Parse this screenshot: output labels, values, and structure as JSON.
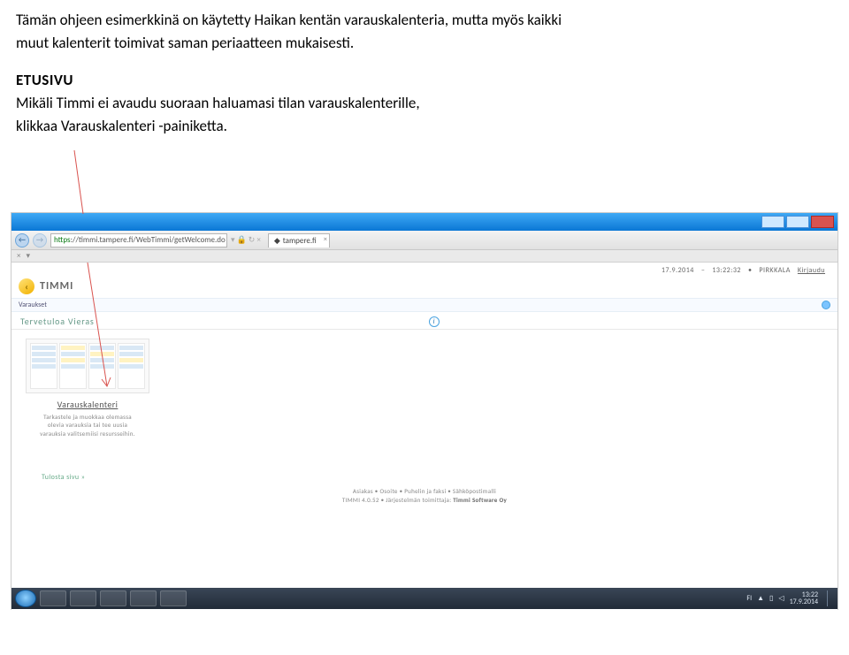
{
  "doc": {
    "line1": "Tämän ohjeen esimerkkinä on käytetty Haikan kentän varauskalenteria, mutta myös kaikki",
    "line2": "muut kalenterit toimivat saman periaatteen mukaisesti.",
    "heading": "ETUSIVU",
    "line3": "Mikäli Timmi ei avaudu suoraan haluamasi tilan varauskalenterille,",
    "line4": "klikkaa Varauskalenteri -painiketta."
  },
  "browser": {
    "url_https": "https",
    "url_rest": "://timmi.tampere.fi/WebTimmi/getWelcome.do",
    "tab_label": "tampere.fi",
    "subbar_x": "×",
    "subbar_down": "▾"
  },
  "topline": {
    "date": "17.9.2014",
    "sep": "–",
    "time": "13:22:32",
    "dot": "•",
    "place": "PIRKKALA",
    "login": "Kirjaudu"
  },
  "brand": {
    "glyph": "‹",
    "text": "TIMMI"
  },
  "tabs": {
    "item1": "Varaukset"
  },
  "welcome": "Tervetuloa  Vieras",
  "card": {
    "title": "Varauskalenteri",
    "desc1": "Tarkastele ja muokkaa olemassa",
    "desc2": "olevia varauksia tai tee uusia",
    "desc3": "varauksia valitsemiisi resursseihin."
  },
  "print": "Tulosta sivu »",
  "footer": {
    "l1": "Asiakas • Osoite • Puhelin ja faksi • Sähköpostimalli",
    "l2a": "TIMMI 4.0.52 • Järjestelmän toimittaja: ",
    "l2b": "Timmi Software Oy"
  },
  "tray": {
    "lang": "FI",
    "up": "▲",
    "flag1": "▯",
    "flag2": "◁",
    "time": "13:22",
    "date": "17.9.2014"
  }
}
